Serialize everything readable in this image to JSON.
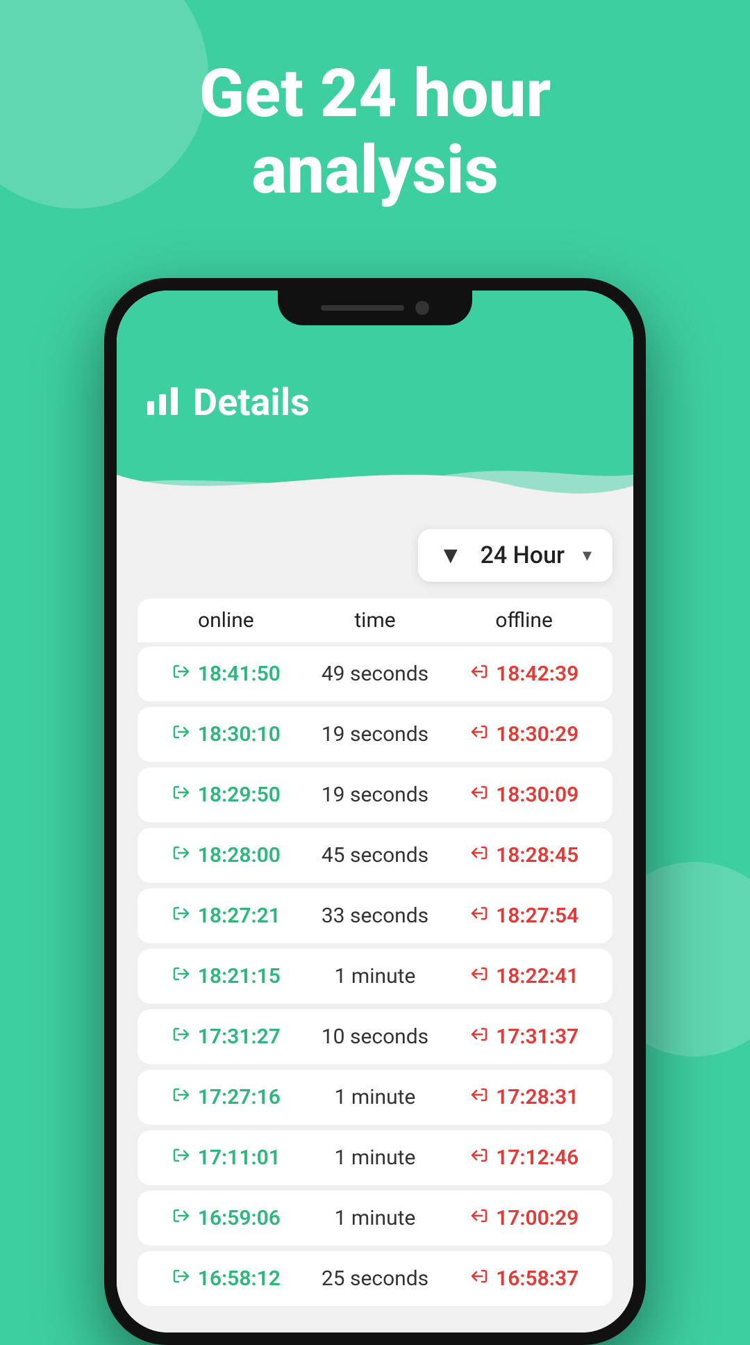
{
  "background": {
    "color": "#3ecfa0"
  },
  "hero": {
    "title_line1": "Get 24 hour",
    "title_line2": "analysis"
  },
  "phone": {
    "header": {
      "icon": "📊",
      "title": "Details"
    },
    "filter": {
      "icon": "▼",
      "label": "24 Hour",
      "arrow": "▾"
    },
    "table": {
      "headers": [
        "online",
        "time",
        "offline"
      ],
      "rows": [
        {
          "online": "18:41:50",
          "duration": "49 seconds",
          "offline": "18:42:39"
        },
        {
          "online": "18:30:10",
          "duration": "19 seconds",
          "offline": "18:30:29"
        },
        {
          "online": "18:29:50",
          "duration": "19 seconds",
          "offline": "18:30:09"
        },
        {
          "online": "18:28:00",
          "duration": "45 seconds",
          "offline": "18:28:45"
        },
        {
          "online": "18:27:21",
          "duration": "33 seconds",
          "offline": "18:27:54"
        },
        {
          "online": "18:21:15",
          "duration": "1 minute",
          "offline": "18:22:41"
        },
        {
          "online": "17:31:27",
          "duration": "10 seconds",
          "offline": "17:31:37"
        },
        {
          "online": "17:27:16",
          "duration": "1 minute",
          "offline": "17:28:31"
        },
        {
          "online": "17:11:01",
          "duration": "1 minute",
          "offline": "17:12:46"
        },
        {
          "online": "16:59:06",
          "duration": "1 minute",
          "offline": "17:00:29"
        },
        {
          "online": "16:58:12",
          "duration": "25 seconds",
          "offline": "16:58:37"
        }
      ]
    }
  }
}
